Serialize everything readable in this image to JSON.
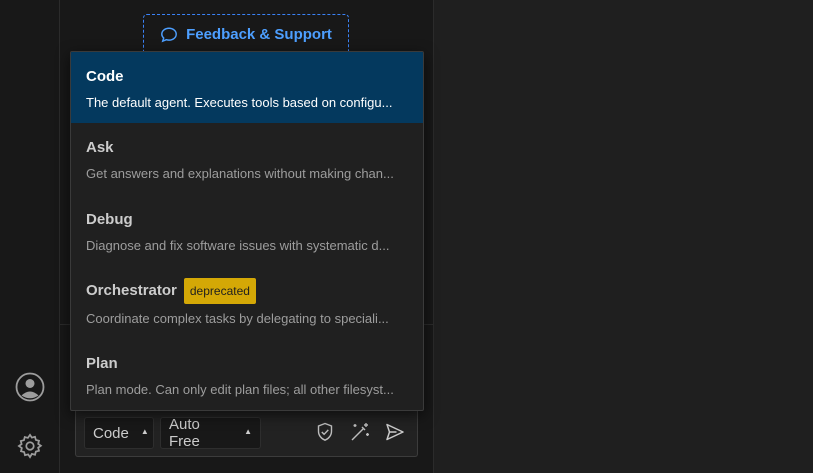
{
  "feedback": {
    "label": "Feedback & Support"
  },
  "mode_menu": {
    "items": [
      {
        "name": "Code",
        "description": "The default agent. Executes tools based on configu...",
        "selected": true
      },
      {
        "name": "Ask",
        "description": "Get answers and explanations without making chan..."
      },
      {
        "name": "Debug",
        "description": "Diagnose and fix software issues with systematic d..."
      },
      {
        "name": "Orchestrator",
        "badge": "deprecated",
        "description": "Coordinate complex tasks by delegating to speciali..."
      },
      {
        "name": "Plan",
        "description": "Plan mode. Can only edit plan files; all other filesyst..."
      }
    ]
  },
  "composer": {
    "mode_select": "Code",
    "model_select": "Auto Free"
  },
  "icons": {
    "account": "account-icon",
    "settings": "gear-icon",
    "feedback": "chat-bubble-icon",
    "shield": "shield-icon",
    "enhance": "magic-wand-icon",
    "send": "send-icon"
  },
  "colors": {
    "selected_bg": "#04395e",
    "accent_blue": "#4d9fff",
    "badge": "#d4a806"
  }
}
